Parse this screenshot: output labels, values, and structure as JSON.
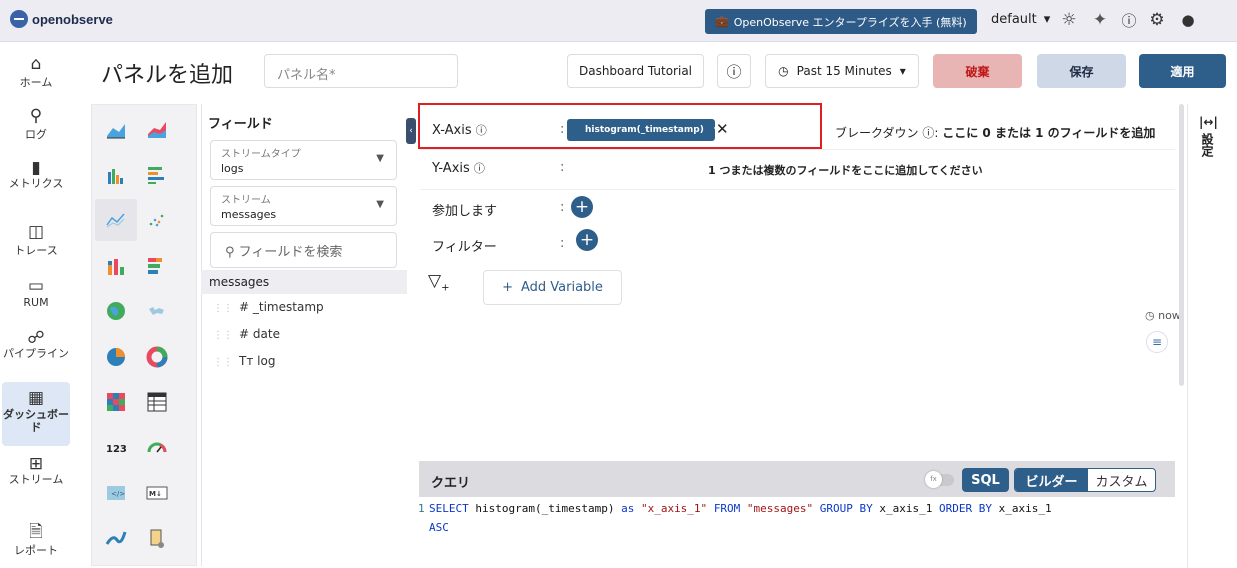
{
  "topbar": {
    "logo_text": "openobserve",
    "enterprise_button": "OpenObserve エンタープライズを入手 (無料)",
    "org": "default",
    "icons": [
      "sun-icon",
      "slack-icon",
      "help-icon",
      "gear-icon",
      "user-icon"
    ]
  },
  "nav": {
    "items": [
      {
        "label": "ホーム",
        "icon": "home-icon"
      },
      {
        "label": "ログ",
        "icon": "search-icon"
      },
      {
        "label": "メトリクス",
        "icon": "bar-chart-icon"
      },
      {
        "label": "トレース",
        "icon": "trace-icon"
      },
      {
        "label": "RUM",
        "icon": "monitor-icon"
      },
      {
        "label": "パイプライン",
        "icon": "pipeline-icon"
      },
      {
        "label": "ダッシュボード",
        "icon": "dashboard-icon"
      },
      {
        "label": "ストリーム",
        "icon": "stream-icon"
      },
      {
        "label": "レポート",
        "icon": "report-icon"
      }
    ],
    "active": "ダッシュボード"
  },
  "header": {
    "title": "パネルを追加",
    "panel_name_placeholder": "パネル名*",
    "dashboard_tutorial": "Dashboard Tutorial",
    "time_range": "Past 15 Minutes",
    "discard": "破棄",
    "save": "保存",
    "apply": "適用"
  },
  "fields": {
    "title": "フィールド",
    "stream_type_label": "ストリームタイプ",
    "stream_type_value": "logs",
    "stream_label": "ストリーム",
    "stream_value": "messages",
    "search_placeholder": "フィールドを検索",
    "stream_name": "messages",
    "list": [
      {
        "type": "#",
        "name": "_timestamp"
      },
      {
        "type": "#",
        "name": "date"
      },
      {
        "type": "Tт",
        "name": "log"
      }
    ]
  },
  "config": {
    "x_axis_label": "X-Axis",
    "x_axis_chip": "histogram(_timestamp)",
    "breakdown_label": "ブレークダウン",
    "breakdown_hint": "ここに 0 または 1 のフィールドを追加",
    "y_axis_label": "Y-Axis",
    "y_axis_hint": "1 つまたは複数のフィールドをここに追加してください",
    "join_label": "参加します",
    "filter_label": "フィルター",
    "add_variable": "Add Variable",
    "now_label": "now"
  },
  "settings": {
    "label": "設定"
  },
  "query": {
    "title": "クエリ",
    "mode_sql": "SQL",
    "mode_builder": "ビルダー",
    "mode_custom": "カスタム",
    "line_number": "1",
    "sql_parts": {
      "select": "SELECT",
      "expr": " histogram(_timestamp) ",
      "as": "as",
      "alias": " \"x_axis_1\" ",
      "from": "FROM",
      "table": " \"messages\"  ",
      "group": "GROUP BY",
      "g1": " x_axis_1 ",
      "order": "ORDER BY",
      "o1": " x_axis_1",
      "asc": "ASC"
    }
  },
  "colors": {
    "accent": "#2e5e8a",
    "discard": "#e8a0a0",
    "save": "#cfd8e6",
    "apply": "#2e5e8a",
    "highlight": "#e02020"
  }
}
